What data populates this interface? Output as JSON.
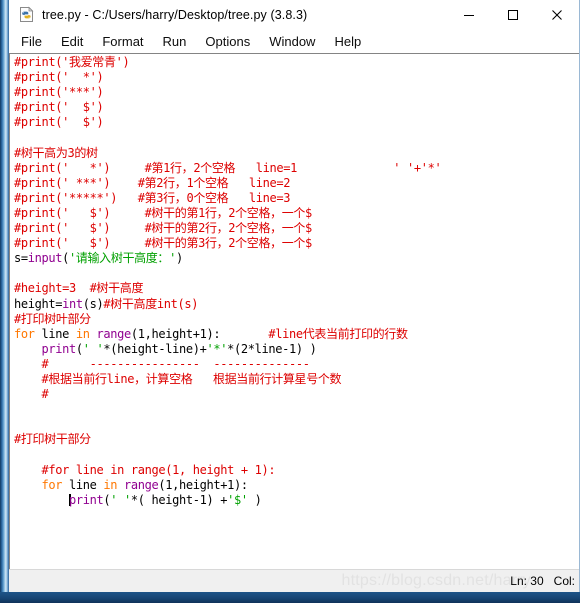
{
  "window": {
    "title": "tree.py - C:/Users/harry/Desktop/tree.py (3.8.3)",
    "icon": "python-file-icon",
    "controls": {
      "minimize": "minimize-icon",
      "maximize": "maximize-icon",
      "close": "close-icon"
    }
  },
  "menubar": {
    "items": [
      {
        "label": "File"
      },
      {
        "label": "Edit"
      },
      {
        "label": "Format"
      },
      {
        "label": "Run"
      },
      {
        "label": "Options"
      },
      {
        "label": "Window"
      },
      {
        "label": "Help"
      }
    ]
  },
  "colors": {
    "comment": "#dd0000",
    "string": "#00a000",
    "keyword": "#ff7700",
    "builtin": "#900090",
    "plain": "#000000",
    "titlebar_bg": "#ffffff",
    "editor_bg": "#ffffff",
    "statusbar_bg": "#f0f0f0",
    "desktop_bg": "#1d4f80"
  },
  "editor": {
    "lines": [
      {
        "n": 1,
        "segments": [
          {
            "t": "#print('我爱常青')",
            "c": "cmt"
          }
        ]
      },
      {
        "n": 2,
        "segments": [
          {
            "t": "#print('  *')",
            "c": "cmt"
          }
        ]
      },
      {
        "n": 3,
        "segments": [
          {
            "t": "#print('***')",
            "c": "cmt"
          }
        ]
      },
      {
        "n": 4,
        "segments": [
          {
            "t": "#print('  $')",
            "c": "cmt"
          }
        ]
      },
      {
        "n": 5,
        "segments": [
          {
            "t": "#print('  $')",
            "c": "cmt"
          }
        ]
      },
      {
        "n": 6,
        "segments": []
      },
      {
        "n": 7,
        "segments": [
          {
            "t": "#树干高为3的树",
            "c": "cmt"
          }
        ]
      },
      {
        "n": 8,
        "segments": [
          {
            "t": "#print('   *')     #第1行，2个空格   line=1              ' '+'*'",
            "c": "cmt"
          }
        ]
      },
      {
        "n": 9,
        "segments": [
          {
            "t": "#print(' ***')    #第2行，1个空格   line=2",
            "c": "cmt"
          }
        ]
      },
      {
        "n": 10,
        "segments": [
          {
            "t": "#print('*****')   #第3行，0个空格   line=3",
            "c": "cmt"
          }
        ]
      },
      {
        "n": 11,
        "segments": [
          {
            "t": "#print('   $')     #树干的第1行，2个空格，一个$",
            "c": "cmt"
          }
        ]
      },
      {
        "n": 12,
        "segments": [
          {
            "t": "#print('   $')     #树干的第2行，2个空格，一个$",
            "c": "cmt"
          }
        ]
      },
      {
        "n": 13,
        "segments": [
          {
            "t": "#print('   $')     #树干的第3行，2个空格，一个$",
            "c": "cmt"
          }
        ]
      },
      {
        "n": 14,
        "segments": [
          {
            "t": "s=",
            "c": "pln"
          },
          {
            "t": "input",
            "c": "bi"
          },
          {
            "t": "(",
            "c": "pln"
          },
          {
            "t": "'请输入树干高度：'",
            "c": "str"
          },
          {
            "t": ")",
            "c": "pln"
          }
        ]
      },
      {
        "n": 15,
        "segments": []
      },
      {
        "n": 16,
        "segments": [
          {
            "t": "#height=3  #树干高度",
            "c": "cmt"
          }
        ]
      },
      {
        "n": 17,
        "segments": [
          {
            "t": "height=",
            "c": "pln"
          },
          {
            "t": "int",
            "c": "bi"
          },
          {
            "t": "(s)",
            "c": "pln"
          },
          {
            "t": "#树干高度int(s)",
            "c": "cmt"
          }
        ]
      },
      {
        "n": 18,
        "segments": [
          {
            "t": "#打印树叶部分",
            "c": "cmt"
          }
        ]
      },
      {
        "n": 19,
        "segments": [
          {
            "t": "for",
            "c": "kw"
          },
          {
            "t": " line ",
            "c": "pln"
          },
          {
            "t": "in",
            "c": "kw"
          },
          {
            "t": " ",
            "c": "pln"
          },
          {
            "t": "range",
            "c": "bi"
          },
          {
            "t": "(1,height+1):       ",
            "c": "pln"
          },
          {
            "t": "#line代表当前打印的行数",
            "c": "cmt"
          }
        ]
      },
      {
        "n": 20,
        "segments": [
          {
            "t": "    ",
            "c": "pln"
          },
          {
            "t": "print",
            "c": "bi"
          },
          {
            "t": "(",
            "c": "pln"
          },
          {
            "t": "' '",
            "c": "str"
          },
          {
            "t": "*(height-line)+",
            "c": "pln"
          },
          {
            "t": "'*'",
            "c": "str"
          },
          {
            "t": "*(2*line-1) )",
            "c": "pln"
          }
        ]
      },
      {
        "n": 21,
        "segments": [
          {
            "t": "    #      ----------------  --------------",
            "c": "cmt"
          }
        ]
      },
      {
        "n": 22,
        "segments": [
          {
            "t": "    #根据当前行line，计算空格   根据当前行计算星号个数",
            "c": "cmt"
          }
        ]
      },
      {
        "n": 23,
        "segments": [
          {
            "t": "    #",
            "c": "cmt"
          }
        ]
      },
      {
        "n": 24,
        "segments": []
      },
      {
        "n": 25,
        "segments": []
      },
      {
        "n": 26,
        "segments": [
          {
            "t": "#打印树干部分",
            "c": "cmt"
          }
        ]
      },
      {
        "n": 27,
        "segments": []
      },
      {
        "n": 28,
        "segments": [
          {
            "t": "    #for line in range(1, height + 1):",
            "c": "cmt"
          }
        ]
      },
      {
        "n": 29,
        "segments": [
          {
            "t": "    ",
            "c": "pln"
          },
          {
            "t": "for",
            "c": "kw"
          },
          {
            "t": " line ",
            "c": "pln"
          },
          {
            "t": "in",
            "c": "kw"
          },
          {
            "t": " ",
            "c": "pln"
          },
          {
            "t": "range",
            "c": "bi"
          },
          {
            "t": "(1,height+1):",
            "c": "pln"
          }
        ]
      },
      {
        "n": 30,
        "segments": [
          {
            "t": "        ",
            "c": "pln"
          },
          {
            "t": "",
            "c": "caret"
          },
          {
            "t": "print",
            "c": "bi"
          },
          {
            "t": "(",
            "c": "pln"
          },
          {
            "t": "' '",
            "c": "str"
          },
          {
            "t": "*( height-1) +",
            "c": "pln"
          },
          {
            "t": "'$'",
            "c": "str"
          },
          {
            "t": " )",
            "c": "pln"
          }
        ]
      }
    ]
  },
  "statusbar": {
    "line_label": "Ln: 30",
    "col_label": "Col:",
    "watermark": "https://blog.csdn.net/harry"
  }
}
